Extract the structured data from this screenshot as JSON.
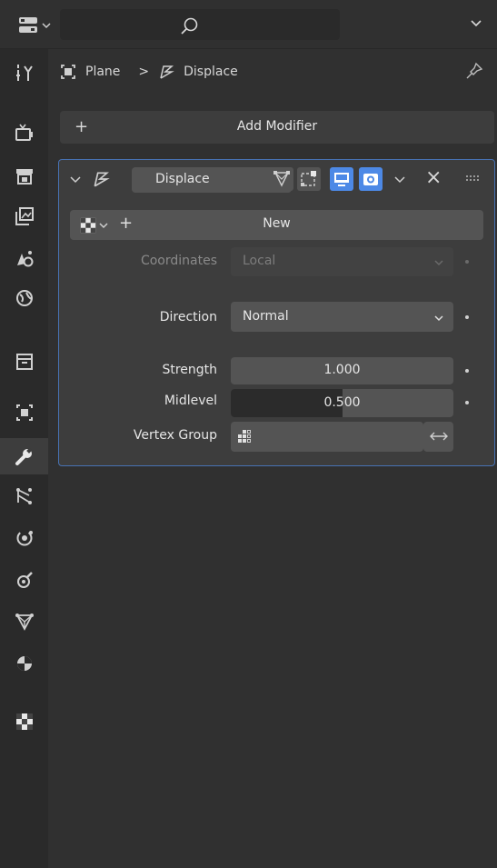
{
  "colors": {
    "accent": "#4772b3",
    "active_toggle": "#4d89e6"
  },
  "header": {
    "object_name": "Plane",
    "separator": ">",
    "modifier_name": "Displace"
  },
  "add_modifier": {
    "plus": "+",
    "label": "Add Modifier"
  },
  "modifier": {
    "name": "Displace",
    "close": "×",
    "texture": {
      "plus": "+",
      "new_label": "New"
    },
    "coordinates": {
      "label": "Coordinates",
      "value": "Local"
    },
    "direction": {
      "label": "Direction",
      "value": "Normal"
    },
    "strength": {
      "label": "Strength",
      "value": "1.000"
    },
    "midlevel": {
      "label": "Midlevel",
      "value": "0.500",
      "fraction": 0.5
    },
    "vertex_group": {
      "label": "Vertex Group",
      "value": ""
    }
  },
  "sidebar_tabs": [
    "tool",
    "render",
    "output",
    "view-layer",
    "scene",
    "world",
    "collection",
    "object",
    "modifiers",
    "particles",
    "physics",
    "constraints",
    "data",
    "material",
    "texture"
  ]
}
